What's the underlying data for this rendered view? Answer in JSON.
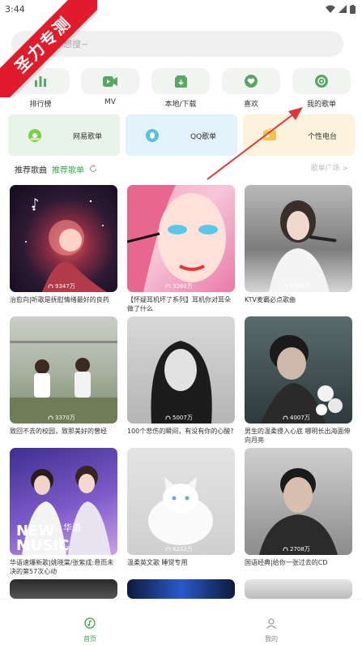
{
  "status_bar": {
    "time": "3:44"
  },
  "promo_ribbon": "圣力专测",
  "search": {
    "placeholder": "搜你想搜~"
  },
  "nav": [
    {
      "label": "排行榜",
      "icon": "chart-bars-icon"
    },
    {
      "label": "MV",
      "icon": "video-icon"
    },
    {
      "label": "本地/下载",
      "icon": "download-icon"
    },
    {
      "label": "喜欢",
      "icon": "heart-icon"
    },
    {
      "label": "我的歌单",
      "icon": "disc-icon"
    }
  ],
  "sources": [
    {
      "label": "网易歌单",
      "icon": "netease-icon",
      "bg": "#e8f4e8"
    },
    {
      "label": "QQ歌单",
      "icon": "qq-icon",
      "bg": "#e3f2fa"
    },
    {
      "label": "个性电台",
      "icon": "radio-icon",
      "bg": "#fdf3dc"
    }
  ],
  "section": {
    "title": "推荐歌曲",
    "subtitle": "推荐歌单",
    "more": "歌单广场 >"
  },
  "playlists": [
    {
      "count": "9347万",
      "desc": "治愈向|听歌是抚慰情绪最好的良药",
      "cover": "cover-night-girl"
    },
    {
      "count": "3260万",
      "desc": "【怀疑耳机坏了系列】耳机你对耳朵做了什么",
      "cover": "cover-popart-girl"
    },
    {
      "count": "6288万",
      "desc": "KTV麦霸必点歌曲",
      "cover": "cover-singer-mic"
    },
    {
      "count": "3370万",
      "desc": "致回不去的校园，致那美好的曾经",
      "cover": "cover-campus"
    },
    {
      "count": "5007万",
      "desc": "100个悲伤的瞬间，有没有你的心酸?",
      "cover": "cover-bw-portrait"
    },
    {
      "count": "4007万",
      "desc": "男生的温柔侵入心底 哪明长出海面伸向月亮",
      "cover": "cover-boy-flowers"
    },
    {
      "count": "109万",
      "desc": "华语速爆新歌|姚晓棠/张紫成:悬而未决的第57次心动",
      "cover": "cover-new-music"
    },
    {
      "count": "4232万",
      "desc": "温柔英文歌 睡觉专用",
      "cover": "cover-white-cat"
    },
    {
      "count": "2708万",
      "desc": "国语经典|给你一张过去的CD",
      "cover": "cover-male-singer"
    }
  ],
  "new_music_cover_text": {
    "line1": "NEW",
    "line2": "MUSIC",
    "tag": "华语"
  },
  "tabs": [
    {
      "label": "首页",
      "icon": "home-music-icon",
      "active": true
    },
    {
      "label": "我的",
      "icon": "person-icon",
      "active": false
    }
  ],
  "colors": {
    "accent": "#38a94a",
    "ribbon": "#e21b2c",
    "arrow": "#e03535"
  }
}
